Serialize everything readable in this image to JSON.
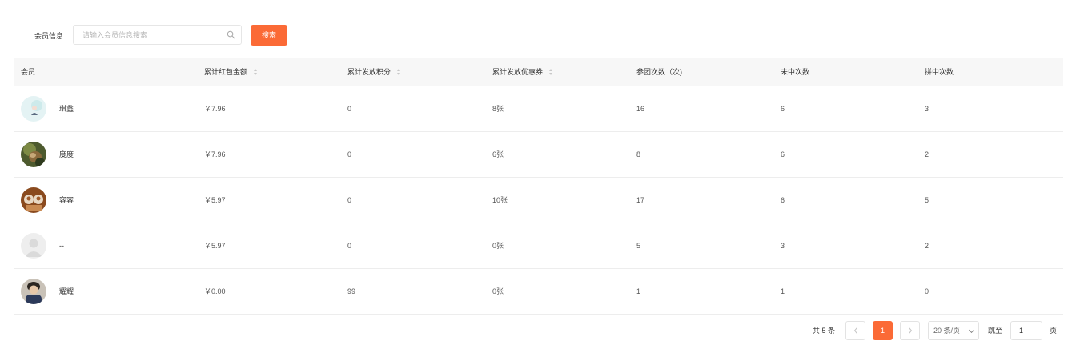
{
  "search": {
    "label": "会员信息",
    "placeholder": "请输入会员信息搜索",
    "value": "",
    "button_label": "搜索"
  },
  "table": {
    "columns": [
      {
        "label": "会员",
        "sortable": false
      },
      {
        "label": "累计红包金额",
        "sortable": true
      },
      {
        "label": "累计发放积分",
        "sortable": true
      },
      {
        "label": "累计发放优惠券",
        "sortable": true
      },
      {
        "label": "参团次数（次)",
        "sortable": false
      },
      {
        "label": "未中次数",
        "sortable": false
      },
      {
        "label": "拼中次数",
        "sortable": false
      }
    ],
    "rows": [
      {
        "name": "琪蠡",
        "red_packet": "￥7.96",
        "points": "0",
        "coupons": "8张",
        "group_count": "16",
        "miss_count": "6",
        "win_count": "3"
      },
      {
        "name": "度度",
        "red_packet": "￥7.96",
        "points": "0",
        "coupons": "6张",
        "group_count": "8",
        "miss_count": "6",
        "win_count": "2"
      },
      {
        "name": "容容",
        "red_packet": "￥5.97",
        "points": "0",
        "coupons": "10张",
        "group_count": "17",
        "miss_count": "6",
        "win_count": "5"
      },
      {
        "name": "--",
        "red_packet": "￥5.97",
        "points": "0",
        "coupons": "0张",
        "group_count": "5",
        "miss_count": "3",
        "win_count": "2"
      },
      {
        "name": "耀耀",
        "red_packet": "￥0.00",
        "points": "99",
        "coupons": "0张",
        "group_count": "1",
        "miss_count": "1",
        "win_count": "0"
      }
    ]
  },
  "pagination": {
    "total_text": "共 5 条",
    "prev_icon": "chevron-left-icon",
    "current_page": "1",
    "next_icon": "chevron-right-icon",
    "page_size": "20 条/页",
    "jump_label": "跳至",
    "jump_value": "1",
    "page_suffix": "页"
  },
  "colors": {
    "accent": "#fb6a36",
    "header_bg": "#f7f7f7",
    "row_border": "#ededed"
  }
}
